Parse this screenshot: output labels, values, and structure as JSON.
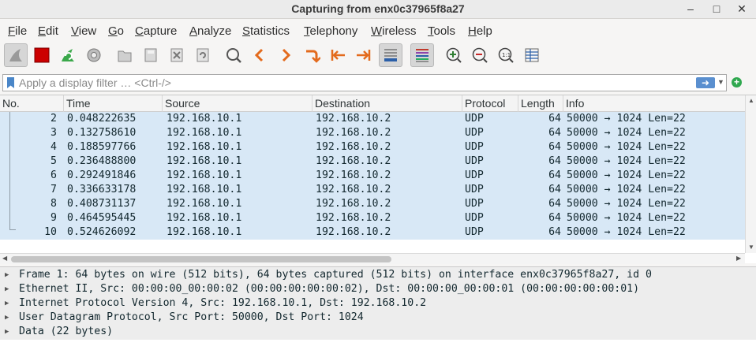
{
  "window": {
    "title": "Capturing from enx0c37965f8a27",
    "minimize": "–",
    "maximize": "□",
    "close": "✕"
  },
  "menu": [
    "File",
    "Edit",
    "View",
    "Go",
    "Capture",
    "Analyze",
    "Statistics",
    "Telephony",
    "Wireless",
    "Tools",
    "Help"
  ],
  "toolbar": {
    "icons": [
      "shark-fin-icon",
      "stop-capture-icon",
      "restart-capture-icon",
      "capture-options-icon",
      "open-file-icon",
      "save-file-icon",
      "close-file-icon",
      "reload-file-icon",
      "find-packet-icon",
      "go-back-icon",
      "go-forward-icon",
      "go-to-packet-icon",
      "first-packet-icon",
      "last-packet-icon",
      "autoscroll-icon",
      "colorize-icon",
      "zoom-in-icon",
      "zoom-out-icon",
      "normal-size-icon",
      "resize-columns-icon"
    ]
  },
  "filter": {
    "placeholder": "Apply a display filter … <Ctrl-/>",
    "apply_label": "➜",
    "add_label": "+"
  },
  "columns": [
    "No.",
    "Time",
    "Source",
    "Destination",
    "Protocol",
    "Length",
    "Info"
  ],
  "packets": [
    {
      "no": "2",
      "time": "0.048222635",
      "source": "192.168.10.1",
      "destination": "192.168.10.2",
      "protocol": "UDP",
      "length": "64",
      "info": "50000 → 1024 Len=22"
    },
    {
      "no": "3",
      "time": "0.132758610",
      "source": "192.168.10.1",
      "destination": "192.168.10.2",
      "protocol": "UDP",
      "length": "64",
      "info": "50000 → 1024 Len=22"
    },
    {
      "no": "4",
      "time": "0.188597766",
      "source": "192.168.10.1",
      "destination": "192.168.10.2",
      "protocol": "UDP",
      "length": "64",
      "info": "50000 → 1024 Len=22"
    },
    {
      "no": "5",
      "time": "0.236488800",
      "source": "192.168.10.1",
      "destination": "192.168.10.2",
      "protocol": "UDP",
      "length": "64",
      "info": "50000 → 1024 Len=22"
    },
    {
      "no": "6",
      "time": "0.292491846",
      "source": "192.168.10.1",
      "destination": "192.168.10.2",
      "protocol": "UDP",
      "length": "64",
      "info": "50000 → 1024 Len=22"
    },
    {
      "no": "7",
      "time": "0.336633178",
      "source": "192.168.10.1",
      "destination": "192.168.10.2",
      "protocol": "UDP",
      "length": "64",
      "info": "50000 → 1024 Len=22"
    },
    {
      "no": "8",
      "time": "0.408731137",
      "source": "192.168.10.1",
      "destination": "192.168.10.2",
      "protocol": "UDP",
      "length": "64",
      "info": "50000 → 1024 Len=22"
    },
    {
      "no": "9",
      "time": "0.464595445",
      "source": "192.168.10.1",
      "destination": "192.168.10.2",
      "protocol": "UDP",
      "length": "64",
      "info": "50000 → 1024 Len=22"
    },
    {
      "no": "10",
      "time": "0.524626092",
      "source": "192.168.10.1",
      "destination": "192.168.10.2",
      "protocol": "UDP",
      "length": "64",
      "info": "50000 → 1024 Len=22"
    }
  ],
  "details": [
    "Frame 1: 64 bytes on wire (512 bits), 64 bytes captured (512 bits) on interface enx0c37965f8a27, id 0",
    "Ethernet II, Src: 00:00:00_00:00:02 (00:00:00:00:00:02), Dst: 00:00:00_00:00:01 (00:00:00:00:00:01)",
    "Internet Protocol Version 4, Src: 192.168.10.1, Dst: 192.168.10.2",
    "User Datagram Protocol, Src Port: 50000, Dst Port: 1024",
    "Data (22 bytes)"
  ],
  "colors": {
    "row_background": "#d8e8f6",
    "stop_red": "#cc0000",
    "accent_blue": "#4a86c8",
    "arrow_orange": "#e36a1c",
    "add_green": "#2fa84f"
  }
}
